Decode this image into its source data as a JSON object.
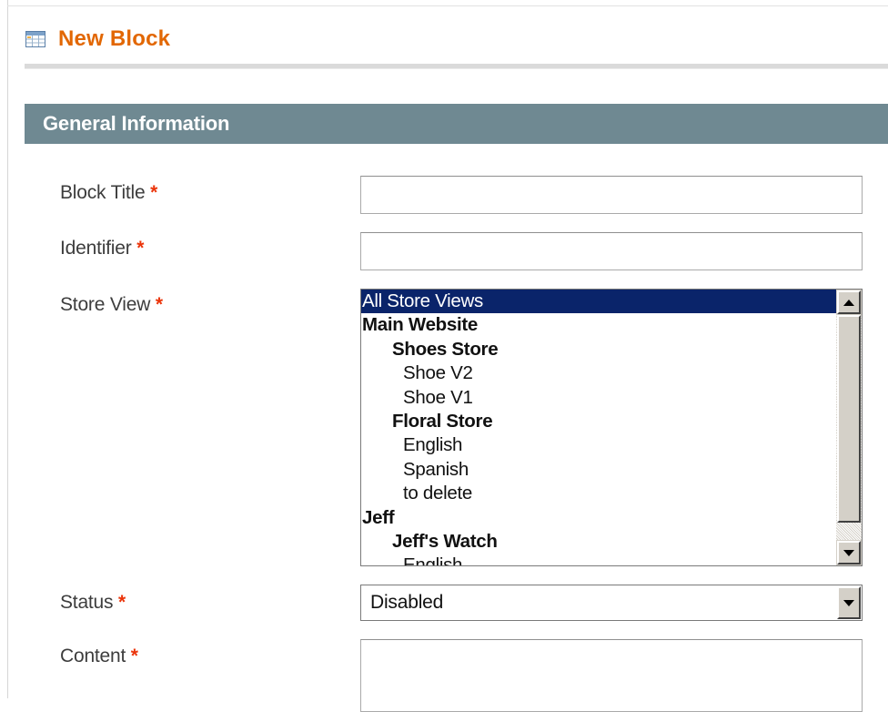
{
  "page": {
    "title": "New Block",
    "icon": "grid-table-icon"
  },
  "section": {
    "title": "General Information"
  },
  "form": {
    "required_marker": "*",
    "block_title": {
      "label": "Block Title",
      "value": ""
    },
    "identifier": {
      "label": "Identifier",
      "value": ""
    },
    "store_view": {
      "label": "Store View",
      "options": [
        {
          "label": "All Store Views",
          "level": 0,
          "group": false,
          "selected": true
        },
        {
          "label": "Main Website",
          "level": 0,
          "group": true,
          "selected": false
        },
        {
          "label": "Shoes Store",
          "level": 1,
          "group": true,
          "selected": false
        },
        {
          "label": "Shoe V2",
          "level": 2,
          "group": false,
          "selected": false
        },
        {
          "label": "Shoe V1",
          "level": 2,
          "group": false,
          "selected": false
        },
        {
          "label": "Floral Store",
          "level": 1,
          "group": true,
          "selected": false
        },
        {
          "label": "English",
          "level": 2,
          "group": false,
          "selected": false
        },
        {
          "label": "Spanish",
          "level": 2,
          "group": false,
          "selected": false
        },
        {
          "label": "to delete",
          "level": 2,
          "group": false,
          "selected": false
        },
        {
          "label": "Jeff",
          "level": 0,
          "group": true,
          "selected": false
        },
        {
          "label": "Jeff's Watch",
          "level": 1,
          "group": true,
          "selected": false
        },
        {
          "label": "English",
          "level": 2,
          "group": false,
          "selected": false
        }
      ]
    },
    "status": {
      "label": "Status",
      "selected": "Disabled"
    },
    "content": {
      "label": "Content",
      "value": ""
    }
  },
  "colors": {
    "title": "#e26703",
    "section_header_bg": "#6f8992",
    "required": "#eb340a",
    "selection_bg": "#0a246a"
  }
}
